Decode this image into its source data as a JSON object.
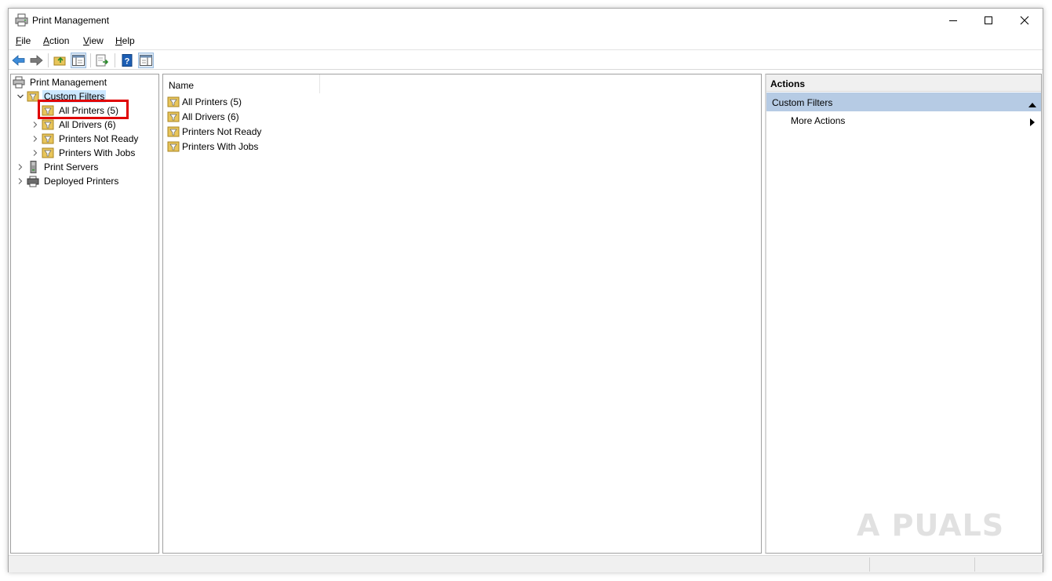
{
  "window": {
    "title": "Print Management",
    "controls": {
      "minimize": "—",
      "maximize": "☐",
      "close": "✕"
    }
  },
  "menu": [
    {
      "accel": "F",
      "rest": "ile"
    },
    {
      "accel": "A",
      "rest": "ction"
    },
    {
      "accel": "V",
      "rest": "iew"
    },
    {
      "accel": "H",
      "rest": "elp"
    }
  ],
  "toolbar": {
    "buttons": [
      "back-arrow-icon",
      "forward-arrow-icon",
      "up-folder-icon",
      "show-hide-tree-icon",
      "export-list-icon",
      "help-icon",
      "show-hide-action-pane-icon"
    ]
  },
  "tree": {
    "root": "Print Management",
    "custom_filters": "Custom Filters",
    "children": [
      "All Printers (5)",
      "All Drivers (6)",
      "Printers Not Ready",
      "Printers With Jobs"
    ],
    "print_servers": "Print Servers",
    "deployed_printers": "Deployed Printers"
  },
  "list": {
    "column_header": "Name",
    "items": [
      "All Printers (5)",
      "All Drivers (6)",
      "Printers Not Ready",
      "Printers With Jobs"
    ]
  },
  "actions": {
    "header": "Actions",
    "group": "Custom Filters",
    "items": [
      "More Actions"
    ]
  },
  "watermark": "A  PUALS",
  "colors": {
    "selection": "#cce8ff",
    "actions_group": "#b6cbe4",
    "highlight": "#e00000",
    "folder": "#e8c55a"
  }
}
